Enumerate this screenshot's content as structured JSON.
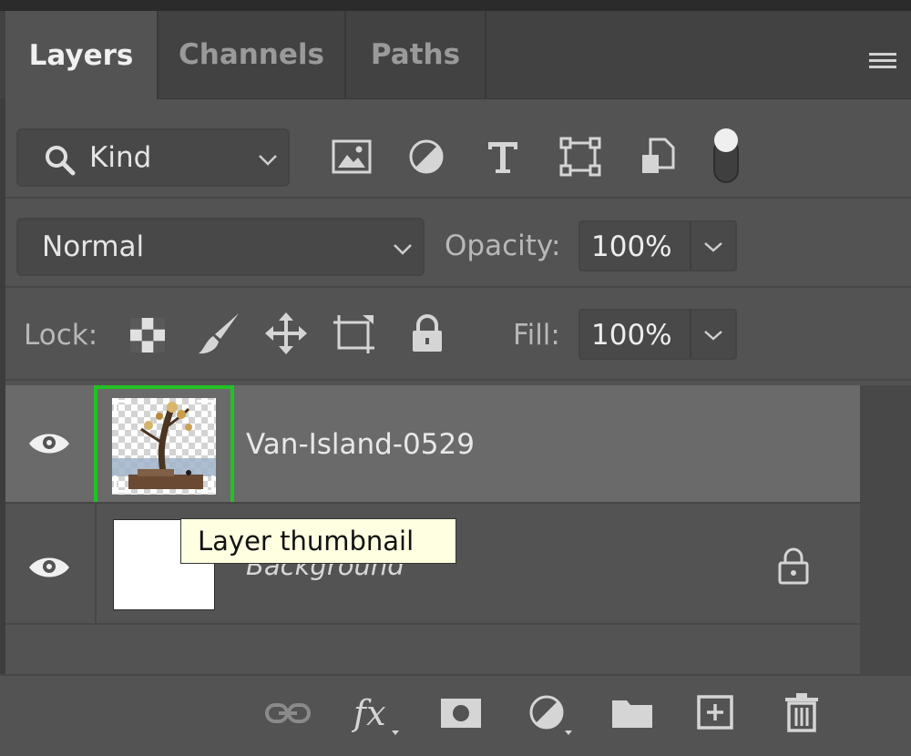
{
  "tabs": [
    {
      "label": "Layers",
      "active": true
    },
    {
      "label": "Channels",
      "active": false
    },
    {
      "label": "Paths",
      "active": false
    }
  ],
  "filter": {
    "kind_label": "Kind",
    "icons": [
      "image-filter-icon",
      "adjustment-filter-icon",
      "type-filter-icon",
      "shape-filter-icon",
      "smart-object-filter-icon",
      "filter-toggle-icon"
    ]
  },
  "blend": {
    "mode": "Normal",
    "opacity_label": "Opacity:",
    "opacity_value": "100%",
    "fill_label": "Fill:",
    "fill_value": "100%"
  },
  "lock": {
    "label": "Lock:",
    "icons": [
      "lock-transparent-pixels-icon",
      "lock-image-pixels-icon",
      "lock-position-icon",
      "lock-artboard-icon",
      "lock-all-icon"
    ]
  },
  "layers": [
    {
      "name": "Van-Island-0529",
      "selected": true,
      "visible": true
    },
    {
      "name": "Background",
      "selected": false,
      "visible": true,
      "locked": true
    }
  ],
  "tooltip": "Layer thumbnail",
  "colors": {
    "panel": "#535353",
    "tab_bar": "#424242",
    "selected_row": "#6a6a6a",
    "highlight": "#23c224",
    "tooltip_bg": "#ffffe1"
  },
  "bottom_icons": [
    "link-layers-icon",
    "fx-icon",
    "layer-mask-icon",
    "adjustment-layer-icon",
    "group-folder-icon",
    "new-layer-icon",
    "trash-icon"
  ]
}
